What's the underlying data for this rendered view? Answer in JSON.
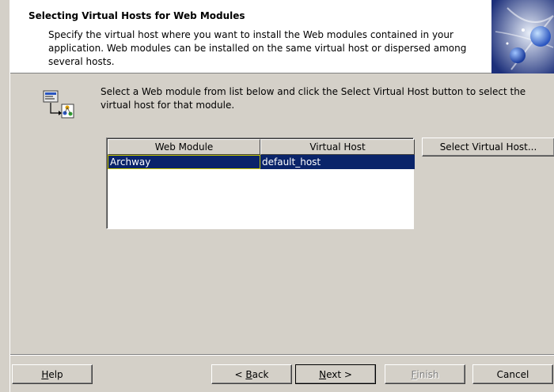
{
  "header": {
    "title": "Selecting Virtual Hosts for Web Modules",
    "description": "Specify the virtual host where you want to install the Web modules contained in your application. Web modules can be installed on the same virtual host or dispersed among several hosts."
  },
  "instruction": "Select a Web module from list below and click the Select Virtual Host button to select the virtual host for that module.",
  "table": {
    "columns": [
      "Web Module",
      "Virtual Host"
    ],
    "rows": [
      {
        "web_module": "Archway",
        "virtual_host": "default_host",
        "selected": true
      }
    ]
  },
  "select_virtual_host_label": "Select Virtual Host...",
  "footer": {
    "help": {
      "mnemonic": "H",
      "rest": "elp"
    },
    "back": {
      "prefix": "< ",
      "mnemonic": "B",
      "rest": "ack"
    },
    "next": {
      "mnemonic": "N",
      "rest": "ext >"
    },
    "finish": {
      "mnemonic": "F",
      "rest": "inish",
      "enabled": false
    },
    "cancel": {
      "label": "Cancel"
    }
  },
  "colors": {
    "dialog_bg": "#d4d0c8",
    "selection": "#0a246a",
    "header_bg": "#ffffff"
  },
  "icons": {
    "header": "globe-sparkle-icon",
    "instruction": "module-to-host-icon"
  }
}
